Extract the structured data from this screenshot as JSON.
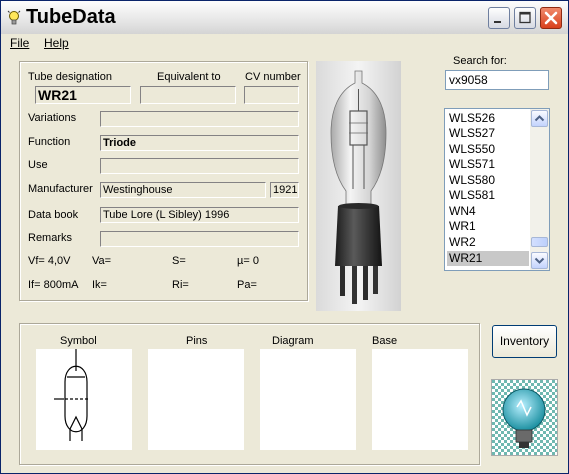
{
  "window": {
    "title": "TubeData"
  },
  "menu": {
    "file": "File",
    "help": "Help"
  },
  "form": {
    "designation_label": "Tube designation",
    "equivalent_label": "Equivalent to",
    "cv_label": "CV number",
    "designation_value": "WR21",
    "equivalent_value": "",
    "cv_value": "",
    "variations_label": "Variations",
    "variations_value": "",
    "function_label": "Function",
    "function_value": "Triode",
    "use_label": "Use",
    "use_value": "",
    "manufacturer_label": "Manufacturer",
    "manufacturer_value": "Westinghouse",
    "year_value": "1921",
    "databook_label": "Data book",
    "databook_value": "Tube Lore (L Sibley) 1996",
    "remarks_label": "Remarks",
    "remarks_value": "",
    "vf": "Vf= 4,0V",
    "va": "Va=",
    "s": "S=",
    "mu": "µ=   0",
    "if": "If= 800mA",
    "ik": "Ik=",
    "ri": "Ri=",
    "pa": "Pa="
  },
  "search": {
    "label": "Search for:",
    "value": "vx9058"
  },
  "list": {
    "items": [
      "WLS526",
      "WLS527",
      "WLS550",
      "WLS571",
      "WLS580",
      "WLS581",
      "WN4",
      "WR1",
      "WR2",
      "WR21"
    ],
    "selected": "WR21"
  },
  "panels": {
    "symbol": "Symbol",
    "pins": "Pins",
    "diagram": "Diagram",
    "base": "Base"
  },
  "buttons": {
    "inventory": "Inventory"
  },
  "colors": {
    "title_bar": "#e6e6e6",
    "close_button": "#d9401c",
    "window_bg": "#ece9d8",
    "selection": "#c8c8c8"
  },
  "icons": {
    "app": "lightbulb-icon",
    "minimize": "minimize-icon",
    "maximize": "maximize-icon",
    "close": "close-icon",
    "scroll_up": "chevron-up-icon",
    "scroll_down": "chevron-down-icon"
  }
}
